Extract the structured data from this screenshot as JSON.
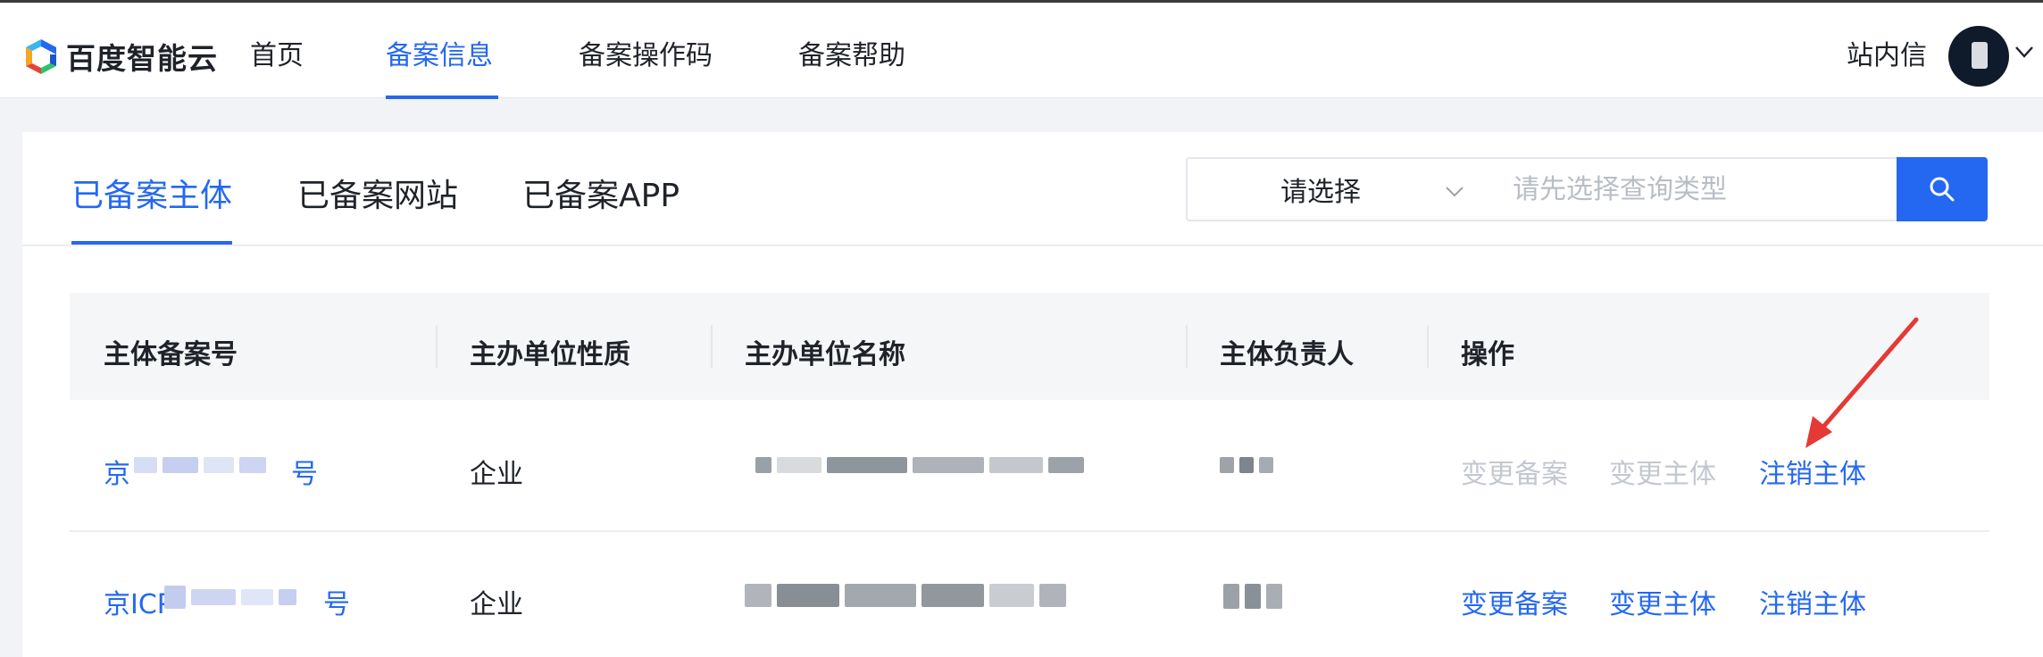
{
  "brand": {
    "name": "百度智能云"
  },
  "nav": {
    "items": [
      {
        "label": "首页",
        "active": false
      },
      {
        "label": "备案信息",
        "active": true
      },
      {
        "label": "备案操作码",
        "active": false
      },
      {
        "label": "备案帮助",
        "active": false
      }
    ],
    "messages_label": "站内信"
  },
  "tabs": [
    {
      "label": "已备案主体",
      "active": true
    },
    {
      "label": "已备案网站",
      "active": false
    },
    {
      "label": "已备案APP",
      "active": false
    }
  ],
  "search": {
    "select_value": "请选择",
    "placeholder": "请先选择查询类型"
  },
  "table": {
    "columns": [
      "主体备案号",
      "主办单位性质",
      "主办单位名称",
      "主体负责人",
      "操作"
    ],
    "rows": [
      {
        "record_no_prefix": "京",
        "record_no_suffix": "号",
        "nature": "企业",
        "actions": [
          {
            "label": "变更备案",
            "enabled": false
          },
          {
            "label": "变更主体",
            "enabled": false
          },
          {
            "label": "注销主体",
            "enabled": true
          }
        ]
      },
      {
        "record_no_prefix": "京ICP",
        "record_no_suffix": "号",
        "nature": "企业",
        "actions": [
          {
            "label": "变更备案",
            "enabled": true
          },
          {
            "label": "变更主体",
            "enabled": true
          },
          {
            "label": "注销主体",
            "enabled": true
          }
        ]
      }
    ]
  },
  "colors": {
    "accent": "#2468f2",
    "annotation": "#e53935",
    "disabled": "#c3c8d0"
  },
  "icons": [
    "baidu-cloud-logo-icon",
    "user-avatar-icon",
    "chevron-down-icon",
    "search-icon",
    "red-arrow-annotation-icon"
  ]
}
